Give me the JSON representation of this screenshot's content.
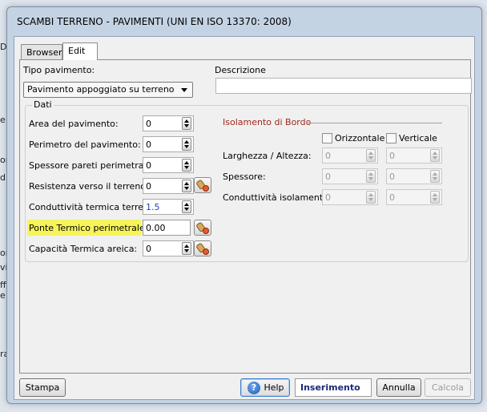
{
  "window": {
    "title": "SCAMBI TERRENO - PAVIMENTI  (UNI EN ISO 13370: 2008)"
  },
  "tabs": [
    {
      "label": "Browser"
    },
    {
      "label": "Edit"
    }
  ],
  "form": {
    "tipo_label": "Tipo pavimento:",
    "tipo_value": "Pavimento appoggiato su terreno",
    "descrizione_label": "Descrizione",
    "descrizione_value": ""
  },
  "dati": {
    "title": "Dati",
    "rows": [
      {
        "label": "Area del pavimento:",
        "value": "0"
      },
      {
        "label": "Perimetro del pavimento:",
        "value": "0"
      },
      {
        "label": "Spessore pareti perimetrali:",
        "value": "0"
      },
      {
        "label": "Resistenza verso il terreno:",
        "value": "0"
      },
      {
        "label": "Conduttività termica terreno:",
        "value": "1.5"
      },
      {
        "label": "Ponte Termico perimetrale:",
        "value": "0.00"
      },
      {
        "label": "Capacità Termica areica:",
        "value": "0"
      }
    ]
  },
  "isolamento": {
    "title": "Isolamento di Bordo",
    "orizzontale_label": "Orizzontale",
    "verticale_label": "Verticale",
    "rows": [
      {
        "label": "Larghezza / Altezza:",
        "orizz": "0",
        "vert": "0"
      },
      {
        "label": "Spessore:",
        "orizz": "0",
        "vert": "0"
      },
      {
        "label": "Conduttività isolamento:",
        "orizz": "0",
        "vert": "0"
      }
    ]
  },
  "buttons": {
    "stampa": "Stampa",
    "help": "Help",
    "status": "Inserimento",
    "annulla": "Annulla",
    "calcola": "Calcola"
  },
  "background": {
    "fragments": [
      "D",
      "e:",
      "ore",
      "dit",
      "ore",
      "vi",
      "ffi",
      "e",
      "ra"
    ]
  },
  "colors": {
    "isolamento_title": "#a0281e",
    "highlight": "#f6f45a",
    "status_text": "#1a2a7a",
    "spin_value_blue": "#1f3fbf"
  }
}
